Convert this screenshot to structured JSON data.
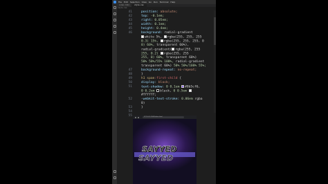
{
  "menu": {
    "items": [
      "File",
      "Edit",
      "Selection",
      "View",
      "Go",
      "Run",
      "Terminal",
      "Help"
    ]
  },
  "tabs": [
    "index.html",
    "style.css"
  ],
  "breadcrumb": "style.css",
  "editor": {
    "lines": [
      {
        "n": "41",
        "segments": [
          {
            "c": "p",
            "t": "position: "
          },
          {
            "c": "v",
            "t": "absolute;"
          }
        ]
      },
      {
        "n": "42",
        "segments": [
          {
            "c": "p",
            "t": "top: "
          },
          {
            "c": "n",
            "t": "-0.1em;"
          }
        ]
      },
      {
        "n": "43",
        "segments": [
          {
            "c": "p",
            "t": "right: "
          },
          {
            "c": "n",
            "t": "0.05em;"
          }
        ]
      },
      {
        "n": "44",
        "segments": [
          {
            "c": "p",
            "t": "width: "
          },
          {
            "c": "n",
            "t": "0.1em;"
          }
        ]
      },
      {
        "n": "45",
        "segments": [
          {
            "c": "p",
            "t": "height: "
          },
          {
            "c": "n",
            "t": "0.4em;"
          }
        ]
      },
      {
        "n": "46",
        "segments": [
          {
            "c": "p",
            "t": "background: "
          },
          {
            "c": "w",
            "t": "radial-gradient"
          }
        ]
      },
      {
        "n": "",
        "segments": [
          {
            "c": "sw",
            "t": "#ffffff"
          },
          {
            "c": "w",
            "t": "white 5%, "
          },
          {
            "c": "sw",
            "t": "#ffffff"
          },
          {
            "c": "w",
            "t": "rgba(255, 255, 255"
          }
        ]
      },
      {
        "n": "",
        "segments": [
          {
            "c": "n",
            "t": "0.3) 15%, "
          },
          {
            "c": "sw",
            "t": "#ffffff"
          },
          {
            "c": "w",
            "t": "rgba(255, 255, 255, 0"
          }
        ]
      },
      {
        "n": "",
        "segments": [
          {
            "c": "n",
            "t": "0) 60%, "
          },
          {
            "c": "w",
            "t": "transparent 60%),"
          }
        ]
      },
      {
        "n": "",
        "segments": [
          {
            "c": "w",
            "t": "radial-gradient("
          },
          {
            "c": "sw",
            "t": "#ffffff"
          },
          {
            "c": "w",
            "t": "rgba(255, 255"
          }
        ]
      },
      {
        "n": "",
        "segments": [
          {
            "c": "n",
            "t": "255, 0.2) "
          },
          {
            "c": "sw",
            "t": "#ffffff"
          },
          {
            "c": "w",
            "t": "rgba(255, 255"
          }
        ]
      },
      {
        "n": "",
        "segments": [
          {
            "c": "n",
            "t": "255, 0) 60%, "
          },
          {
            "c": "w",
            "t": "transparent 60%)"
          }
        ]
      },
      {
        "n": "",
        "segments": [
          {
            "c": "n",
            "t": "50% 50%/55% 100%, "
          },
          {
            "c": "w",
            "t": "radial-gradient"
          }
        ]
      },
      {
        "n": "",
        "segments": [
          {
            "c": "w",
            "t": "transparent 60%) "
          },
          {
            "c": "n",
            "t": "50% 50%/100% 55%;"
          }
        ]
      },
      {
        "n": "47",
        "segments": [
          {
            "c": "p",
            "t": "background-repeat: "
          },
          {
            "c": "v",
            "t": "no-repeat;"
          }
        ]
      },
      {
        "n": "48",
        "segments": [
          {
            "c": "w",
            "t": "}"
          }
        ]
      },
      {
        "n": "49",
        "segments": [
          {
            "c": "k",
            "t": "h1 span"
          },
          {
            "c": "s",
            "t": ":first-child"
          },
          {
            "c": "w",
            "t": " {"
          }
        ]
      },
      {
        "n": "50",
        "segments": [
          {
            "c": "p",
            "t": "display: "
          },
          {
            "c": "v",
            "t": "block;"
          }
        ]
      },
      {
        "n": "51",
        "segments": [
          {
            "c": "p",
            "t": "text-shadow: "
          },
          {
            "c": "n",
            "t": "0 0.1em "
          },
          {
            "c": "sw",
            "t": "#8b5cf6"
          },
          {
            "c": "w",
            "t": "#8b5cf6, "
          }
        ]
      },
      {
        "n": "",
        "segments": [
          {
            "c": "n",
            "t": "0 0.2em "
          },
          {
            "c": "sw",
            "t": "#000000"
          },
          {
            "c": "w",
            "t": "black, "
          },
          {
            "c": "n",
            "t": "0 0.5em "
          },
          {
            "c": "sw",
            "t": "#ffffff"
          }
        ]
      },
      {
        "n": "",
        "segments": [
          {
            "c": "w",
            "t": "#ffffff;"
          }
        ]
      },
      {
        "n": "52",
        "segments": [
          {
            "c": "p",
            "t": "-webkit-text-stroke: "
          },
          {
            "c": "n",
            "t": "0.06em "
          },
          {
            "c": "w",
            "t": "rgba"
          }
        ]
      },
      {
        "n": "",
        "segments": [
          {
            "c": "w",
            "t": "0)"
          }
        ]
      },
      {
        "n": "53",
        "segments": [
          {
            "c": "w",
            "t": "}"
          }
        ]
      },
      {
        "n": "54",
        "segments": [
          {
            "c": "w",
            "t": ""
          }
        ]
      },
      {
        "n": "55",
        "segments": [
          {
            "c": "w",
            "t": ""
          }
        ]
      }
    ]
  },
  "preview": {
    "url": "127.0.0.1:5500/index.html",
    "title_line1": "SAYYED",
    "title_line2": "SAYYED"
  },
  "colors": {
    "editor_bg": "#1e1e1e",
    "property": "#9cdcfe",
    "value": "#ce9178",
    "number": "#b5cea8",
    "selector": "#d7ba7d",
    "accent_purple": "#8b5cf6"
  }
}
